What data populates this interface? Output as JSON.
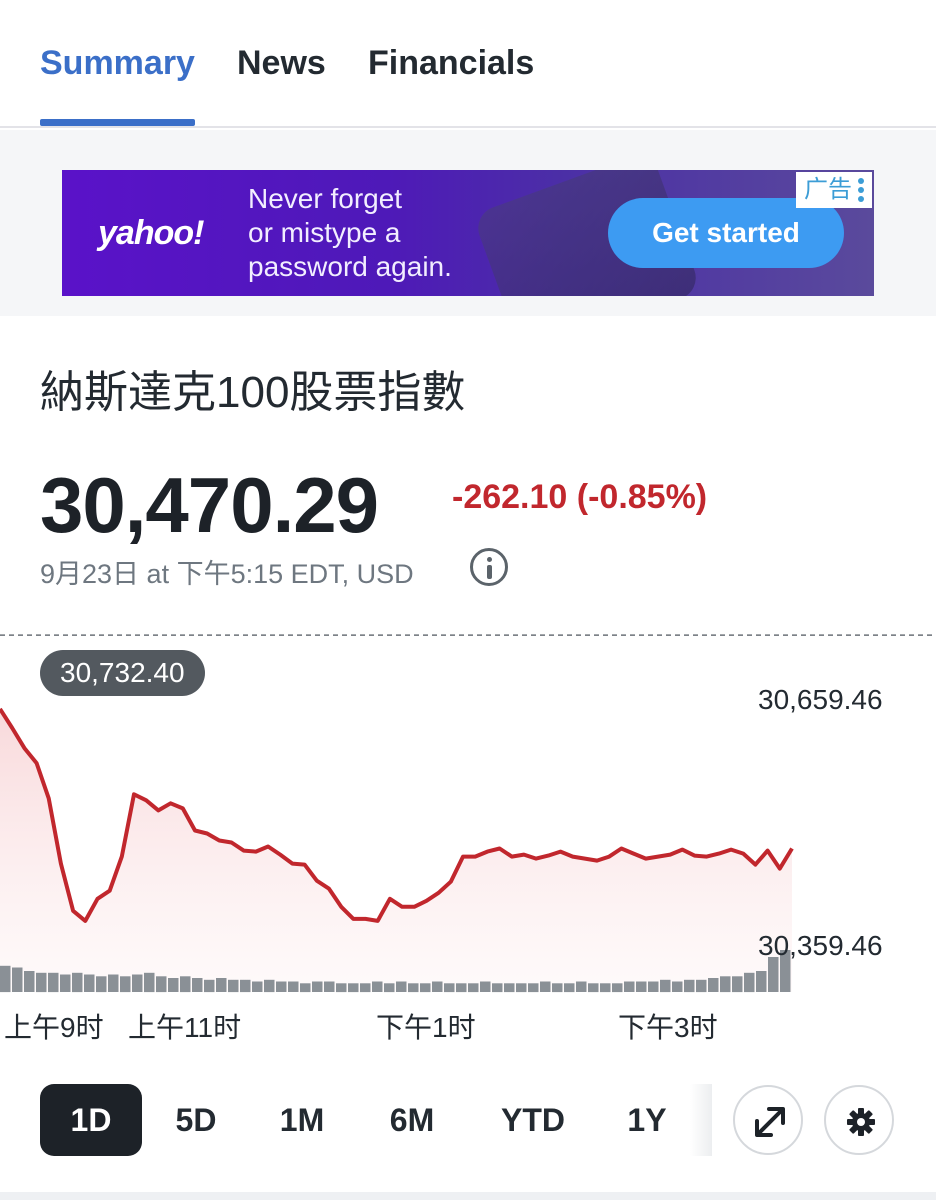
{
  "tabs": [
    {
      "label": "Summary",
      "active": true
    },
    {
      "label": "News",
      "active": false
    },
    {
      "label": "Financials",
      "active": false
    }
  ],
  "ad": {
    "logo": "yahoo!",
    "headline_lines": [
      "Never forget",
      "or mistype a",
      "password again."
    ],
    "cta": "Get started",
    "badge": "广告",
    "menu_icon": "vertical-dots-icon"
  },
  "quote": {
    "name": "納斯達克100股票指數",
    "price": "30,470.29",
    "change": "-262.10 (-0.85%)",
    "timestamp": "9月23日 at 下午5:15 EDT, USD",
    "change_color": "#c1272d"
  },
  "chart_data": {
    "type": "line",
    "previous_close": "30,732.40",
    "y_labels": [
      "30,659.46",
      "30,359.46"
    ],
    "ylim": [
      30329.46,
      30747.46
    ],
    "x_labels": [
      "上午9时",
      "上午11时",
      "下午1时",
      "下午3时"
    ],
    "x_label_positions_hours": [
      9.5,
      11,
      13,
      15
    ],
    "xlim_hours": [
      9.5,
      16
    ],
    "series": [
      {
        "color": "#c1272d",
        "x": [
          9.5,
          9.6,
          9.7,
          9.8,
          9.9,
          10.0,
          10.1,
          10.2,
          10.3,
          10.4,
          10.5,
          10.6,
          10.7,
          10.8,
          10.9,
          11.0,
          11.1,
          11.2,
          11.3,
          11.4,
          11.5,
          11.6,
          11.7,
          11.8,
          11.9,
          12.0,
          12.1,
          12.2,
          12.3,
          12.4,
          12.5,
          12.6,
          12.7,
          12.8,
          12.9,
          13.0,
          13.1,
          13.2,
          13.3,
          13.4,
          13.5,
          13.6,
          13.7,
          13.8,
          13.9,
          14.0,
          14.1,
          14.2,
          14.3,
          14.4,
          14.5,
          14.6,
          14.7,
          14.8,
          14.9,
          15.0,
          15.1,
          15.2,
          15.3,
          15.4,
          15.5,
          15.6,
          15.7,
          15.8,
          15.9,
          16.0
        ],
        "values": [
          30659,
          30640,
          30620,
          30605,
          30570,
          30505,
          30458,
          30448,
          30470,
          30478,
          30512,
          30574,
          30568,
          30558,
          30565,
          30560,
          30538,
          30535,
          30528,
          30526,
          30518,
          30517,
          30522,
          30514,
          30505,
          30504,
          30488,
          30480,
          30462,
          30450,
          30450,
          30448,
          30470,
          30462,
          30462,
          30468,
          30476,
          30487,
          30512,
          30512,
          30517,
          30520,
          30512,
          30514,
          30510,
          30513,
          30517,
          30512,
          30510,
          30508,
          30512,
          30520,
          30515,
          30510,
          30512,
          30514,
          30519,
          30513,
          30512,
          30515,
          30519,
          30515,
          30504,
          30518,
          30500,
          30520
        ]
      }
    ],
    "volume": [
      30,
      28,
      24,
      22,
      22,
      20,
      22,
      20,
      18,
      20,
      18,
      20,
      22,
      18,
      16,
      18,
      16,
      14,
      16,
      14,
      14,
      12,
      14,
      12,
      12,
      10,
      12,
      12,
      10,
      10,
      10,
      12,
      10,
      12,
      10,
      10,
      12,
      10,
      10,
      10,
      12,
      10,
      10,
      10,
      10,
      12,
      10,
      10,
      12,
      10,
      10,
      10,
      12,
      12,
      12,
      14,
      12,
      14,
      14,
      16,
      18,
      18,
      22,
      24,
      40,
      48
    ]
  },
  "ranges": [
    {
      "label": "1D",
      "active": true
    },
    {
      "label": "5D",
      "active": false
    },
    {
      "label": "1M",
      "active": false
    },
    {
      "label": "6M",
      "active": false
    },
    {
      "label": "YTD",
      "active": false
    },
    {
      "label": "1Y",
      "active": false
    }
  ],
  "controls": {
    "expand_icon": "expand-arrows-icon",
    "settings_icon": "gear-icon"
  }
}
